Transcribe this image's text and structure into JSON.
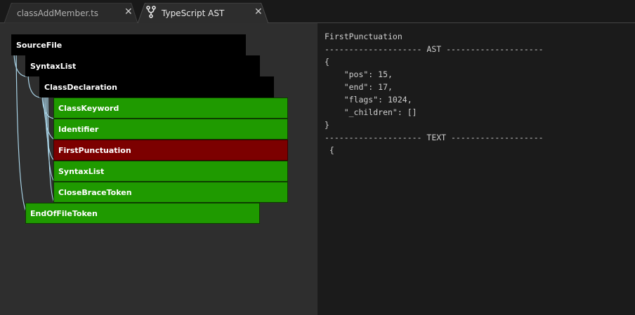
{
  "tabs": [
    {
      "label": "classAddMember.ts",
      "active": false
    },
    {
      "label": "TypeScript AST",
      "active": true,
      "icon": "fork-icon"
    }
  ],
  "tree": {
    "nodes": [
      {
        "label": "SourceFile",
        "depth": 0,
        "state": "container"
      },
      {
        "label": "SyntaxList",
        "depth": 1,
        "state": "container"
      },
      {
        "label": "ClassDeclaration",
        "depth": 2,
        "state": "container"
      },
      {
        "label": "ClassKeyword",
        "depth": 3,
        "state": "leaf"
      },
      {
        "label": "Identifier",
        "depth": 3,
        "state": "leaf"
      },
      {
        "label": "FirstPunctuation",
        "depth": 3,
        "state": "selected"
      },
      {
        "label": "SyntaxList",
        "depth": 3,
        "state": "leaf"
      },
      {
        "label": "CloseBraceToken",
        "depth": 3,
        "state": "leaf"
      },
      {
        "label": "EndOfFileToken",
        "depth": 1,
        "state": "leaf"
      }
    ]
  },
  "details": {
    "title": "FirstPunctuation",
    "ast_header": "-------------------- AST --------------------",
    "ast_lines": [
      "{",
      "    \"pos\": 15,",
      "    \"end\": 17,",
      "    \"flags\": 1024,",
      "    \"_children\": []",
      "}"
    ],
    "text_header": "-------------------- TEXT -------------------",
    "text_value": " {"
  },
  "colors": {
    "container": "#000000",
    "leaf": "#1f9a00",
    "selected": "#7c0000",
    "tree_line": "#a9d3e6"
  }
}
